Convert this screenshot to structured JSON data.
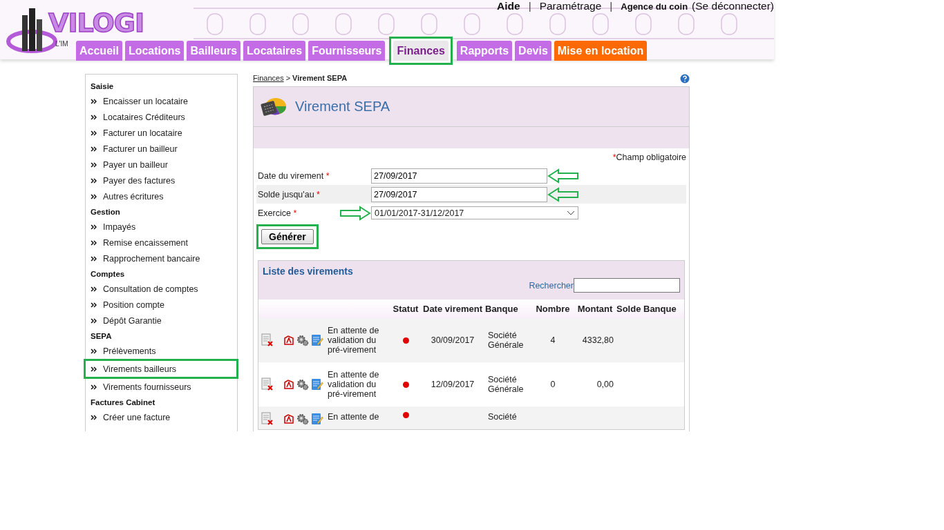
{
  "header": {
    "logo": {
      "name": "VILOGI",
      "tagline": "L'IM"
    },
    "top_links": [
      {
        "label": "Aide",
        "kind": "bold"
      },
      {
        "label": "|",
        "kind": "separator"
      },
      {
        "label": "Paramétrage",
        "kind": "link"
      },
      {
        "label": "|",
        "kind": "separator"
      },
      {
        "label": "Agence du coin",
        "kind": "agency"
      },
      {
        "label": "(Se déconnecter)",
        "kind": "link"
      }
    ],
    "tabs": [
      {
        "label": "Accueil",
        "selected": false,
        "highlighted": false,
        "color": "#c46be6"
      },
      {
        "label": "Locations",
        "selected": false,
        "highlighted": false,
        "color": "#c46be6"
      },
      {
        "label": "Bailleurs",
        "selected": false,
        "highlighted": false,
        "color": "#c46be6"
      },
      {
        "label": "Locataires",
        "selected": false,
        "highlighted": false,
        "color": "#c46be6"
      },
      {
        "label": "Fournisseurs",
        "selected": false,
        "highlighted": false,
        "color": "#c46be6"
      },
      {
        "label": "Finances",
        "selected": true,
        "highlighted": true,
        "color": "#ebe8ec"
      },
      {
        "label": "Rapports",
        "selected": false,
        "highlighted": false,
        "color": "#c46be6"
      },
      {
        "label": "Devis",
        "selected": false,
        "highlighted": false,
        "color": "#c46be6"
      },
      {
        "label": "Mise en location",
        "selected": false,
        "highlighted": false,
        "color": "#ff6a00"
      }
    ]
  },
  "sidebar": {
    "sections": [
      {
        "title": "Saisie",
        "items": [
          {
            "label": "Encaisser un locataire",
            "highlighted": false
          },
          {
            "label": "Locataires Créditeurs",
            "highlighted": false
          },
          {
            "label": "Facturer un locataire",
            "highlighted": false
          },
          {
            "label": "Facturer un bailleur",
            "highlighted": false
          },
          {
            "label": "Payer un bailleur",
            "highlighted": false
          },
          {
            "label": "Payer des factures",
            "highlighted": false
          },
          {
            "label": "Autres écritures",
            "highlighted": false
          }
        ]
      },
      {
        "title": "Gestion",
        "items": [
          {
            "label": "Impayés",
            "highlighted": false
          },
          {
            "label": "Remise encaissement",
            "highlighted": false
          },
          {
            "label": "Rapprochement bancaire",
            "highlighted": false
          }
        ]
      },
      {
        "title": "Comptes",
        "items": [
          {
            "label": "Consultation de comptes",
            "highlighted": false
          },
          {
            "label": "Position compte",
            "highlighted": false
          },
          {
            "label": "Dépôt Garantie",
            "highlighted": false
          }
        ]
      },
      {
        "title": "SEPA",
        "items": [
          {
            "label": "Prélèvements",
            "highlighted": false
          },
          {
            "label": "Virements bailleurs",
            "highlighted": true
          },
          {
            "label": "Virements fournisseurs",
            "highlighted": false
          }
        ]
      },
      {
        "title": "Factures Cabinet",
        "items": [
          {
            "label": "Créer une facture",
            "highlighted": false
          }
        ]
      }
    ]
  },
  "breadcrumb": {
    "link": "Finances",
    "separator": ">",
    "current": "Virement SEPA"
  },
  "panel": {
    "title": "Virement SEPA",
    "required_note": "Champ obligatoire",
    "required_mark": "*",
    "fields": [
      {
        "label": "Date du virement",
        "kind": "text",
        "value": "27/09/2017",
        "arrow_points_left": true,
        "arrow_points_right": false
      },
      {
        "label": "Solde jusqu'au",
        "kind": "text",
        "value": "27/09/2017",
        "arrow_points_left": true,
        "arrow_points_right": false
      },
      {
        "label": "Exercice",
        "kind": "select",
        "value": "01/01/2017-31/12/2017",
        "arrow_points_left": false,
        "arrow_points_right": true
      }
    ],
    "generate_button": {
      "label": "Générer",
      "highlighted": true
    }
  },
  "list": {
    "title": "Liste des virements",
    "search_label": "Rechercher",
    "columns": [
      "Statut",
      "Date virement",
      "Banque",
      "Nombre",
      "Montant",
      "Solde Banque"
    ],
    "rows": [
      {
        "status": "En attente de validation du pré-virement",
        "color": "#e00000",
        "date": "30/09/2017",
        "bank": "Société Générale",
        "count": "4",
        "amount": "4332,80"
      },
      {
        "status": "En attente de validation du pré-virement",
        "color": "#e00000",
        "date": "12/09/2017",
        "bank": "Société Générale",
        "count": "0",
        "amount": "0,00"
      },
      {
        "status": "En attente de",
        "color": "#e00000",
        "bank": "Société"
      }
    ]
  }
}
